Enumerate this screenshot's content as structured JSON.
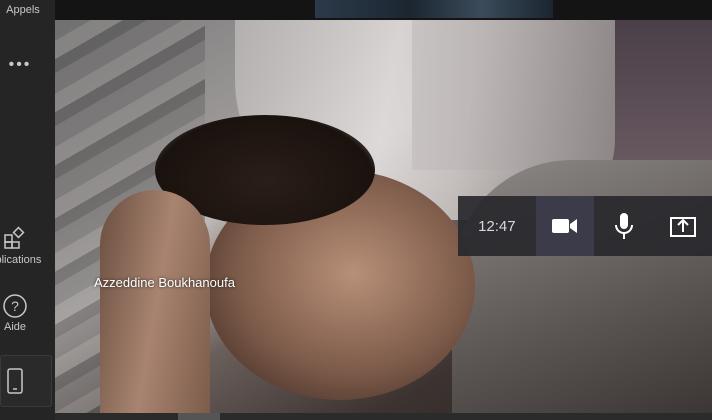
{
  "rail": {
    "calls_label": "Appels",
    "more_label": "•••",
    "apps_label": "Applications",
    "help_label": "Aide"
  },
  "video": {
    "participant_name": "Azzeddine Boukhanoufa"
  },
  "toolbar": {
    "timer": "12:47",
    "camera_icon": "video-camera-icon",
    "mic_icon": "microphone-icon",
    "share_icon": "share-screen-icon"
  },
  "colors": {
    "toolbar_bg": "#28282c",
    "active_button": "#3b3b49",
    "rail_bg": "#252525"
  }
}
